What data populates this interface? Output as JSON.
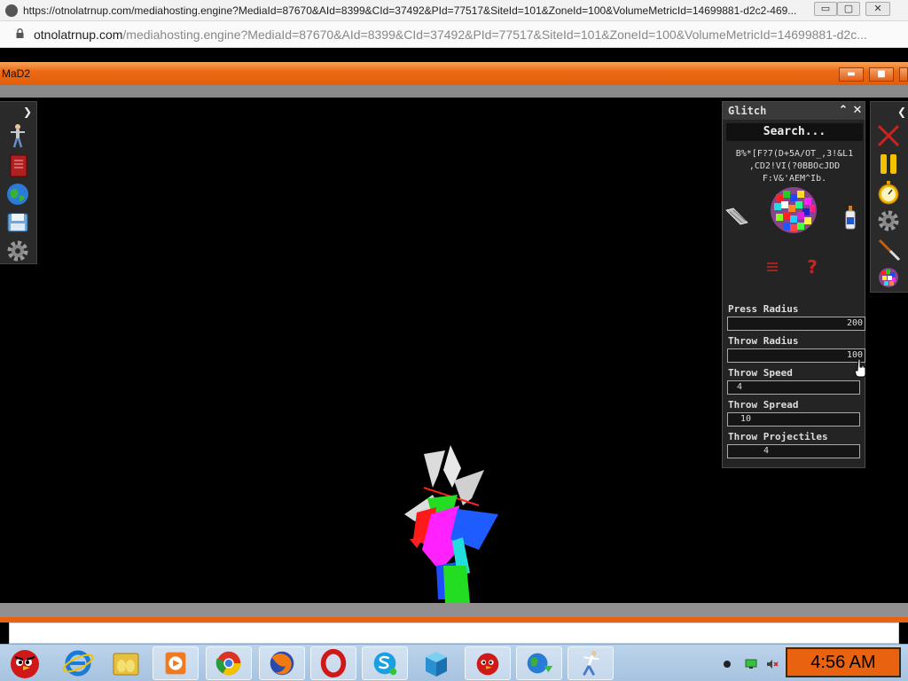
{
  "browser": {
    "title_url": "https://otnolatrnup.com/mediahosting.engine?MediaId=87670&AId=8399&CId=37492&PId=77517&SiteId=101&ZoneId=100&VolumeMetricId=14699881-d2c2-469...",
    "address_host": "otnolatrnup.com",
    "address_path": "/mediahosting.engine?MediaId=87670&AId=8399&CId=37492&PId=77517&SiteId=101&ZoneId=100&VolumeMetricId=14699881-d2c...",
    "minimize_glyph": "▭",
    "maximize_glyph": "▢",
    "close_glyph": "✕"
  },
  "app": {
    "title": "MaD2",
    "minimize_glyph": "▬",
    "maximize_glyph": "■",
    "accent_color": "#e8620f"
  },
  "left_toolbar": {
    "expand_glyph": "❯",
    "icons": [
      "stickman-icon",
      "book-icon",
      "globe-icon",
      "save-icon",
      "gear-icon"
    ]
  },
  "right_toolbar": {
    "collapse_glyph": "❮",
    "icons": [
      "close-x-icon",
      "pause-icon",
      "stopwatch-icon",
      "gear-icon",
      "knife-icon",
      "blob-icon"
    ]
  },
  "panel": {
    "title": "Glitch",
    "collapse_glyph": "⌃",
    "close_glyph": "✕",
    "search_placeholder": "Search...",
    "code_line1": "B%*[F?7(D+5A/OT_,3!&L1",
    "code_line2": ",CD2!VI(?0BBOcJDD",
    "code_line3": "F:V&'AEM^Ib.",
    "help_glyph": "?",
    "fields": [
      {
        "label": "Press Radius",
        "value": "200"
      },
      {
        "label": "Throw Radius",
        "value": "100"
      },
      {
        "label": "Throw Speed",
        "value": "4"
      },
      {
        "label": "Throw Spread",
        "value": "10"
      },
      {
        "label": "Throw Projectiles",
        "value": "4"
      }
    ]
  },
  "taskbar": {
    "apps": [
      "angry-birds-start-icon",
      "internet-explorer-icon",
      "file-explorer-icon",
      "media-player-icon",
      "chrome-icon",
      "firefox-icon",
      "opera-icon",
      "skype-icon",
      "box-app-icon",
      "angry-birds-icon",
      "globe-download-icon",
      "stickman-app-icon"
    ],
    "clock": "4:56 AM"
  }
}
